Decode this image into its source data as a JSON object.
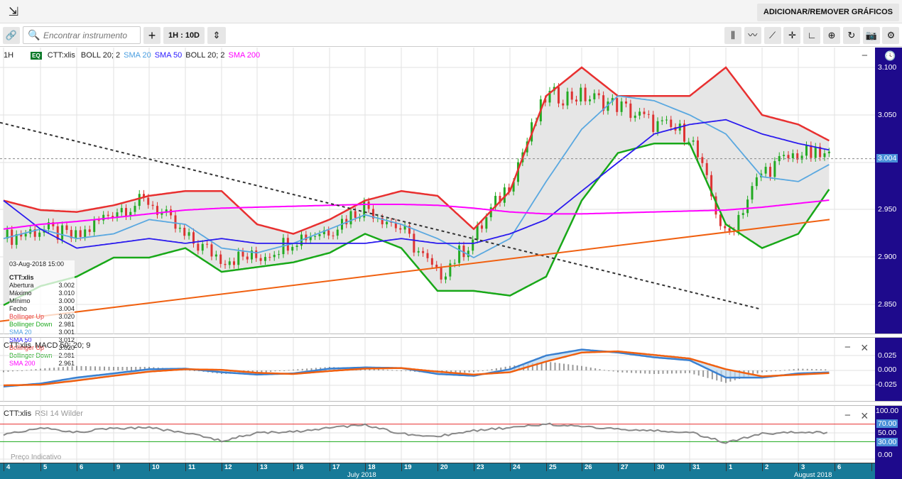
{
  "topbar": {
    "expand_icon": "arrow-down-left-icon",
    "add_remove_label": "ADICIONAR/REMOVER GRÁFICOS"
  },
  "toolbar": {
    "link_icon": "link-icon",
    "search_placeholder": "Encontrar instrumento",
    "add_label": "+",
    "interval_label": "1H : 10D",
    "resize_icon": "split-icon",
    "right_tools": [
      "candles-icon",
      "indicators-icon",
      "line-draw-icon",
      "crosshair-icon",
      "curve-icon",
      "zoom-icon",
      "refresh-icon",
      "camera-icon",
      "gear-icon"
    ]
  },
  "main": {
    "interval": "1H",
    "badge": "EQ",
    "symbol": "CTT:xlis",
    "studies": [
      {
        "label": "BOLL 20; 2",
        "color": "#222222"
      },
      {
        "label": "SMA 20",
        "color": "#4a9ee0"
      },
      {
        "label": "SMA 50",
        "color": "#2a1aff"
      },
      {
        "label": "BOLL 20; 2",
        "color": "#222222"
      },
      {
        "label": "SMA 200",
        "color": "#ff00ff"
      }
    ],
    "minimize": "−",
    "tooltip": {
      "datetime": "03-Aug-2018 15:00",
      "symbol": "CTT:xlis",
      "rows": [
        {
          "label": "Abertura",
          "value": "3.002",
          "color": "#222222"
        },
        {
          "label": "Máximo",
          "value": "3.010",
          "color": "#222222"
        },
        {
          "label": "Mínimo",
          "value": "3.000",
          "color": "#222222"
        },
        {
          "label": "Fecho",
          "value": "3.004",
          "color": "#222222"
        },
        {
          "label": "Bollinger Up",
          "value": "3.020",
          "color": "#e84040"
        },
        {
          "label": "Bollinger Down",
          "value": "2.981",
          "color": "#22aa22"
        },
        {
          "label": "SMA 20",
          "value": "3.001",
          "color": "#4a9ee0"
        },
        {
          "label": "SMA 50",
          "value": "3.012",
          "color": "#2a1aff"
        },
        {
          "label": "Bollinger Up",
          "value": "3.020",
          "color": "#e84040"
        },
        {
          "label": "Bollinger Down",
          "value": "2.981",
          "color": "#22aa22"
        },
        {
          "label": "SMA 200",
          "value": "2.961",
          "color": "#ff00ff"
        }
      ]
    },
    "axis_ticks": [
      "3.100",
      "3.050",
      "3.004",
      "2.950",
      "2.900",
      "2.850"
    ],
    "last_price": "3.004"
  },
  "macd": {
    "symbol": "CTT:xlis",
    "label": "MACD 50; 20; 9",
    "axis_ticks": [
      "0.025",
      "0.000",
      "-0.025"
    ]
  },
  "rsi": {
    "symbol": "CTT:xlis",
    "label": "RSI 14 Wilder",
    "axis_ticks": [
      "100.00",
      "70.00",
      "50.00",
      "30.00",
      "0.00"
    ],
    "note": "Preço Indicativo"
  },
  "panel_controls": {
    "minimize": "−",
    "close": "×"
  },
  "dates": [
    "4",
    "5",
    "6",
    "9",
    "10",
    "11",
    "12",
    "13",
    "16",
    "17",
    "18",
    "19",
    "20",
    "23",
    "24",
    "25",
    "26",
    "27",
    "30",
    "31",
    "1",
    "2",
    "3",
    "6"
  ],
  "months": [
    "July 2018",
    "August 2018"
  ],
  "chart_data": [
    {
      "type": "candlestick",
      "title": "CTT:xlis 1H",
      "ylim": [
        2.82,
        3.12
      ],
      "grid": true,
      "x": [
        "Jul 4",
        "Jul 5",
        "Jul 6",
        "Jul 9",
        "Jul 10",
        "Jul 11",
        "Jul 12",
        "Jul 13",
        "Jul 16",
        "Jul 17",
        "Jul 18",
        "Jul 19",
        "Jul 20",
        "Jul 23",
        "Jul 24",
        "Jul 25",
        "Jul 26",
        "Jul 27",
        "Jul 30",
        "Jul 31",
        "Aug 1",
        "Aug 2",
        "Aug 3",
        "Aug 6"
      ],
      "series": [
        {
          "name": "Close",
          "color": "#222222",
          "values": [
            2.92,
            2.93,
            2.92,
            2.95,
            2.96,
            2.92,
            2.9,
            2.9,
            2.92,
            2.93,
            2.955,
            2.93,
            2.88,
            2.92,
            2.98,
            3.07,
            3.07,
            3.06,
            3.04,
            3.03,
            2.92,
            2.99,
            3.01,
            3.004
          ]
        },
        {
          "name": "Bollinger Up",
          "color": "#e83030",
          "values": [
            2.96,
            2.95,
            2.948,
            2.955,
            2.965,
            2.97,
            2.97,
            2.935,
            2.925,
            2.94,
            2.96,
            2.97,
            2.965,
            2.93,
            2.97,
            3.07,
            3.1,
            3.07,
            3.07,
            3.07,
            3.1,
            3.05,
            3.04,
            3.02
          ]
        },
        {
          "name": "Bollinger Down",
          "color": "#18a818",
          "values": [
            2.85,
            2.87,
            2.88,
            2.9,
            2.9,
            2.91,
            2.885,
            2.89,
            2.895,
            2.905,
            2.925,
            2.91,
            2.865,
            2.865,
            2.86,
            2.88,
            2.96,
            3.01,
            3.02,
            3.02,
            2.935,
            2.91,
            2.925,
            2.98
          ]
        },
        {
          "name": "SMA 20",
          "color": "#5aa8e0",
          "values": [
            2.92,
            2.93,
            2.92,
            2.925,
            2.94,
            2.935,
            2.91,
            2.905,
            2.915,
            2.93,
            2.945,
            2.935,
            2.92,
            2.9,
            2.92,
            2.98,
            3.035,
            3.07,
            3.065,
            3.05,
            3.03,
            2.985,
            2.98,
            3.001
          ]
        },
        {
          "name": "SMA 50",
          "color": "#2a1aee",
          "values": [
            2.96,
            2.93,
            2.91,
            2.915,
            2.92,
            2.915,
            2.92,
            2.915,
            2.915,
            2.915,
            2.915,
            2.92,
            2.915,
            2.915,
            2.925,
            2.94,
            2.97,
            3.0,
            3.03,
            3.04,
            3.045,
            3.03,
            3.02,
            3.012
          ]
        },
        {
          "name": "SMA 200",
          "color": "#ff00ff",
          "values": [
            2.93,
            2.935,
            2.938,
            2.942,
            2.946,
            2.95,
            2.952,
            2.953,
            2.954,
            2.955,
            2.956,
            2.956,
            2.955,
            2.952,
            2.948,
            2.946,
            2.946,
            2.947,
            2.948,
            2.949,
            2.95,
            2.953,
            2.957,
            2.961
          ]
        },
        {
          "name": "Trendline down",
          "color": "#333333",
          "dashed": true,
          "points": [
            [
              "Jul 4",
              3.042
            ],
            [
              "Aug 2",
              2.846
            ]
          ]
        },
        {
          "name": "Trendline up",
          "color": "#f06010",
          "points": [
            [
              "Jul 4",
              2.833
            ],
            [
              "Aug 6",
              2.94
            ]
          ]
        }
      ]
    },
    {
      "type": "line",
      "title": "MACD 50; 20; 9",
      "ylim": [
        -0.04,
        0.04
      ],
      "series": [
        {
          "name": "MACD",
          "color": "#3a80d0",
          "values": [
            -0.027,
            -0.022,
            -0.012,
            -0.005,
            0.002,
            0.003,
            -0.003,
            -0.007,
            -0.005,
            0.003,
            0.005,
            0.004,
            -0.006,
            -0.009,
            0.002,
            0.025,
            0.035,
            0.03,
            0.022,
            0.017,
            -0.012,
            -0.012,
            -0.005,
            -0.003
          ]
        },
        {
          "name": "Signal",
          "color": "#f06010",
          "values": [
            -0.025,
            -0.024,
            -0.017,
            -0.009,
            -0.002,
            0.002,
            0.001,
            -0.004,
            -0.006,
            -0.001,
            0.003,
            0.004,
            -0.002,
            -0.007,
            -0.003,
            0.015,
            0.03,
            0.032,
            0.026,
            0.02,
            0.002,
            -0.01,
            -0.007,
            -0.004
          ]
        }
      ]
    },
    {
      "type": "line",
      "title": "RSI 14 Wilder",
      "ylim": [
        0,
        100
      ],
      "levels": [
        70,
        30
      ],
      "series": [
        {
          "name": "RSI",
          "color": "#888888",
          "values": [
            45,
            62,
            52,
            60,
            62,
            50,
            32,
            50,
            52,
            62,
            68,
            48,
            42,
            55,
            62,
            70,
            65,
            58,
            55,
            52,
            28,
            48,
            52,
            50
          ]
        }
      ]
    }
  ]
}
